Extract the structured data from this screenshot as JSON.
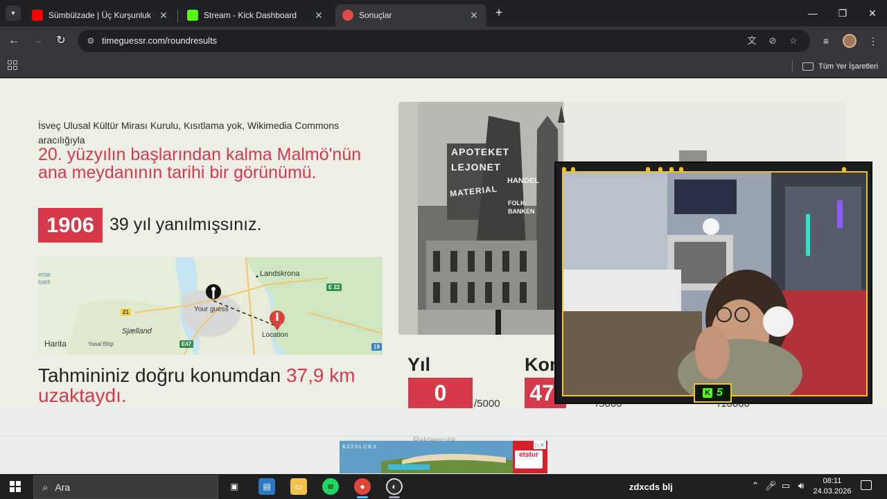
{
  "browser": {
    "tabs": [
      {
        "title": "Sümbülzade | Üç Kurşunluk Op",
        "favicon_color": "#ff0000",
        "active": false
      },
      {
        "title": "Stream - Kick Dashboard",
        "favicon_color": "#53fc18",
        "active": false
      },
      {
        "title": "Sonuçlar",
        "favicon_color": "#e04a4a",
        "active": true
      }
    ],
    "url": "timeguessr.com/roundresults",
    "bookmarks_all": "Tüm Yer İşaretleri"
  },
  "page": {
    "credit": "İsveç Ulusal Kültür Mirası Kurulu, Kısıtlama yok, Wikimedia Commons aracılığıyla",
    "description": "20. yüzyılın başlarından kalma Malmö'nün ana meydanının tarihi bir görünümü.",
    "year": "1906",
    "year_diff_text": "39 yıl yanılmışsınız.",
    "map": {
      "labels": {
        "landskrona": "Landskrona",
        "your_guess": "Your guess",
        "location": "Location",
        "sjaelland": "Sjælland",
        "sound": "ersø\nbælt"
      },
      "road_signs": {
        "e22": "E 22",
        "r21": "21",
        "e47": "E47",
        "r19": "19"
      },
      "attribution": "Harita",
      "legal": "Yasal Bilgi"
    },
    "distance_prefix": "Tahmininiz doğru konumdan ",
    "distance_value": "37,9 km uzaktaydı.",
    "scores": {
      "year_label": "Yıl",
      "year_score": "0",
      "year_max": "/5000",
      "location_label": "Kon",
      "location_score": "47",
      "location_max": "/5000",
      "total_max": "/10000"
    },
    "photo_signs": [
      "APOTEKET",
      "LEJONET",
      "MATERIAL",
      "HANDEL",
      "FOLK-BANKEN"
    ]
  },
  "webcam": {
    "badge_number": "5",
    "badge_logo": "K"
  },
  "ad": {
    "label": "Reklamcılık",
    "brand": "KEFALUKA",
    "partner": "etstur"
  },
  "taskbar": {
    "search_placeholder": "Ara",
    "user_text": "zdxcds",
    "user_text2": "blj",
    "time": "08:11",
    "date": "24.03.2026"
  }
}
